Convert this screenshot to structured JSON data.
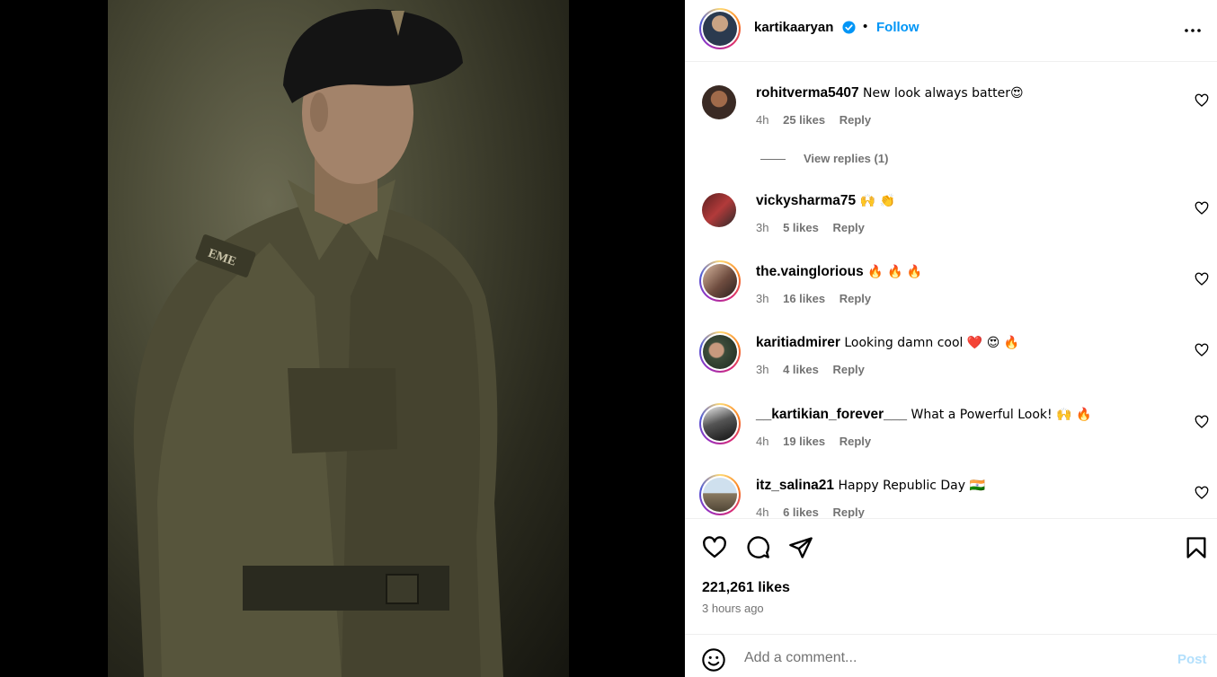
{
  "post": {
    "username": "kartikaaryan",
    "verified": true,
    "separator": "•",
    "follow_label": "Follow",
    "image_badge_text": "EME"
  },
  "comments": [
    {
      "username": "rohitverma5407",
      "text": " New look always batter😍",
      "time": "4h",
      "likes": "25 likes",
      "reply": "Reply",
      "view_replies": "View replies (1)"
    },
    {
      "username": "vickysharma75",
      "text": " 🙌 👏",
      "time": "3h",
      "likes": "5 likes",
      "reply": "Reply"
    },
    {
      "username": "the.vainglorious",
      "text": " 🔥 🔥 🔥",
      "time": "3h",
      "likes": "16 likes",
      "reply": "Reply"
    },
    {
      "username": "karitiadmirer",
      "text": " Looking damn cool ❤️ 😍 🔥",
      "time": "3h",
      "likes": "4 likes",
      "reply": "Reply"
    },
    {
      "username": "__kartikian_forever___",
      "text": " What a Powerful Look! 🙌 🔥",
      "time": "4h",
      "likes": "19 likes",
      "reply": "Reply"
    },
    {
      "username": "itz_salina21",
      "text": " Happy Republic Day 🇮🇳",
      "time": "4h",
      "likes": "6 likes",
      "reply": "Reply"
    }
  ],
  "actions": {
    "like_count": "221,261 likes",
    "time_ago": "3 hours ago"
  },
  "add_comment": {
    "placeholder": "Add a comment...",
    "post_label": "Post"
  },
  "colors": {
    "accent": "#0095f6",
    "post_disabled": "#b2dffc",
    "muted": "#737373"
  }
}
